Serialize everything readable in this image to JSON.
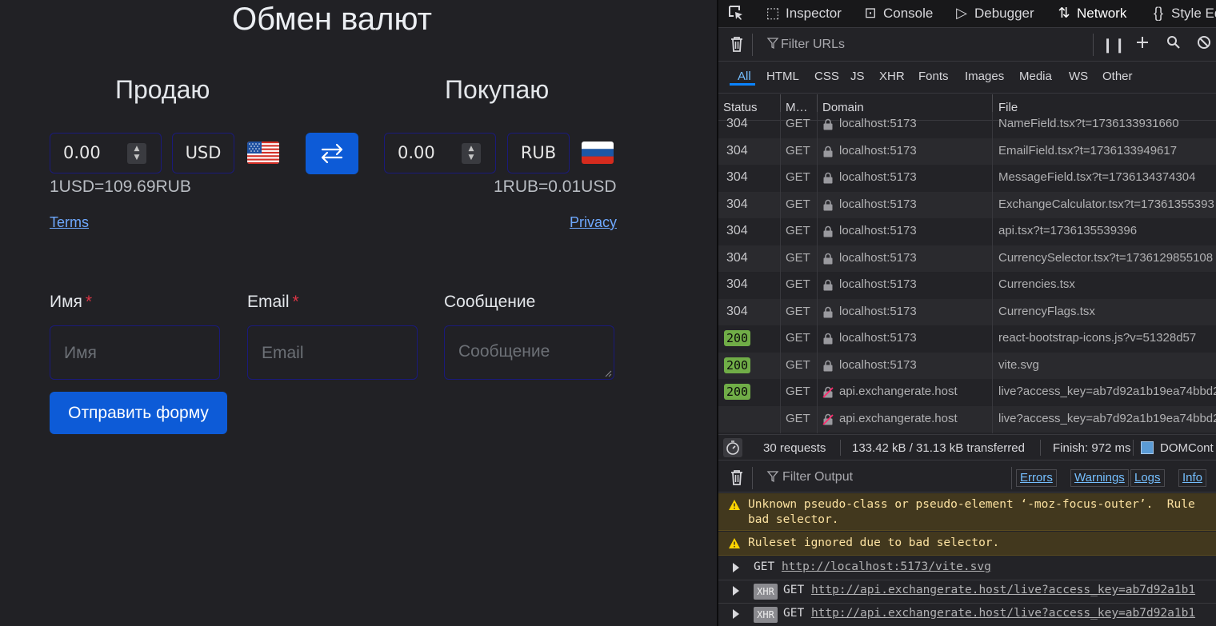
{
  "app": {
    "title": "Обмен валют",
    "sell_heading": "Продаю",
    "buy_heading": "Покупаю",
    "sell_amount": "0.00",
    "sell_currency": "USD",
    "buy_amount": "0.00",
    "buy_currency": "RUB",
    "sell_rate": "1USD=109.69RUB",
    "buy_rate": "1RUB=0.01USD",
    "terms_link": "Terms",
    "privacy_link": "Privacy",
    "form": {
      "name_label": "Имя",
      "name_placeholder": "Имя",
      "email_label": "Email",
      "email_placeholder": "Email",
      "message_label": "Сообщение",
      "message_placeholder": "Сообщение",
      "required_mark": "*",
      "submit_label": "Отправить форму"
    },
    "colors": {
      "primary": "#0d5bd7",
      "link": "#6ea8fe",
      "required": "#dc3545"
    }
  },
  "devtools": {
    "tabs": [
      {
        "label": "Inspector",
        "icon": "inspector-icon"
      },
      {
        "label": "Console",
        "icon": "console-icon"
      },
      {
        "label": "Debugger",
        "icon": "debugger-icon"
      },
      {
        "label": "Network",
        "icon": "network-icon",
        "active": true
      },
      {
        "label": "Style Ed",
        "icon": "style-editor-icon"
      }
    ],
    "filter_placeholder": "Filter URLs",
    "types": [
      "All",
      "HTML",
      "CSS",
      "JS",
      "XHR",
      "Fonts",
      "Images",
      "Media",
      "WS",
      "Other"
    ],
    "columns": {
      "status": "Status",
      "method": "M…",
      "domain": "Domain",
      "file": "File"
    },
    "requests": [
      {
        "status": "304",
        "method": "GET",
        "domain": "localhost:5173",
        "file": "NameField.tsx?t=1736133931660",
        "secure": true
      },
      {
        "status": "304",
        "method": "GET",
        "domain": "localhost:5173",
        "file": "EmailField.tsx?t=1736133949617",
        "secure": true
      },
      {
        "status": "304",
        "method": "GET",
        "domain": "localhost:5173",
        "file": "MessageField.tsx?t=1736134374304",
        "secure": true
      },
      {
        "status": "304",
        "method": "GET",
        "domain": "localhost:5173",
        "file": "ExchangeCalculator.tsx?t=17361355393",
        "secure": true
      },
      {
        "status": "304",
        "method": "GET",
        "domain": "localhost:5173",
        "file": "api.tsx?t=1736135539396",
        "secure": true
      },
      {
        "status": "304",
        "method": "GET",
        "domain": "localhost:5173",
        "file": "CurrencySelector.tsx?t=1736129855108",
        "secure": true
      },
      {
        "status": "304",
        "method": "GET",
        "domain": "localhost:5173",
        "file": "Currencies.tsx",
        "secure": true
      },
      {
        "status": "304",
        "method": "GET",
        "domain": "localhost:5173",
        "file": "CurrencyFlags.tsx",
        "secure": true
      },
      {
        "status": "200",
        "method": "GET",
        "domain": "localhost:5173",
        "file": "react-bootstrap-icons.js?v=51328d57",
        "secure": true
      },
      {
        "status": "200",
        "method": "GET",
        "domain": "localhost:5173",
        "file": "vite.svg",
        "secure": true
      },
      {
        "status": "200",
        "method": "GET",
        "domain": "api.exchangerate.host",
        "file": "live?access_key=ab7d92a1b19ea74bbd2",
        "secure": false
      },
      {
        "status": "",
        "method": "GET",
        "domain": "api.exchangerate.host",
        "file": "live?access_key=ab7d92a1b19ea74bbd2",
        "secure": false
      }
    ],
    "summary": {
      "requests": "30 requests",
      "transferred": "133.42 kB / 31.13 kB transferred",
      "finish": "Finish: 972 ms",
      "domcontent": "DOMCont"
    },
    "console": {
      "filter_placeholder": "Filter Output",
      "filters": [
        "Errors",
        "Warnings",
        "Logs",
        "Info"
      ],
      "messages": [
        {
          "type": "warning",
          "lines": [
            "Unknown pseudo-class or pseudo-element ‘-moz-focus-outer’.  Rule",
            "bad selector."
          ]
        },
        {
          "type": "warning",
          "lines": [
            "Ruleset ignored due to bad selector."
          ]
        },
        {
          "type": "log",
          "method": "GET",
          "url": "http://localhost:5173/vite.svg"
        },
        {
          "type": "xhr",
          "badge": "XHR",
          "method": "GET",
          "url": "http://api.exchangerate.host/live?access_key=ab7d92a1b1"
        },
        {
          "type": "xhr",
          "badge": "XHR",
          "method": "GET",
          "url": "http://api.exchangerate.host/live?access_key=ab7d92a1b1"
        }
      ]
    }
  }
}
